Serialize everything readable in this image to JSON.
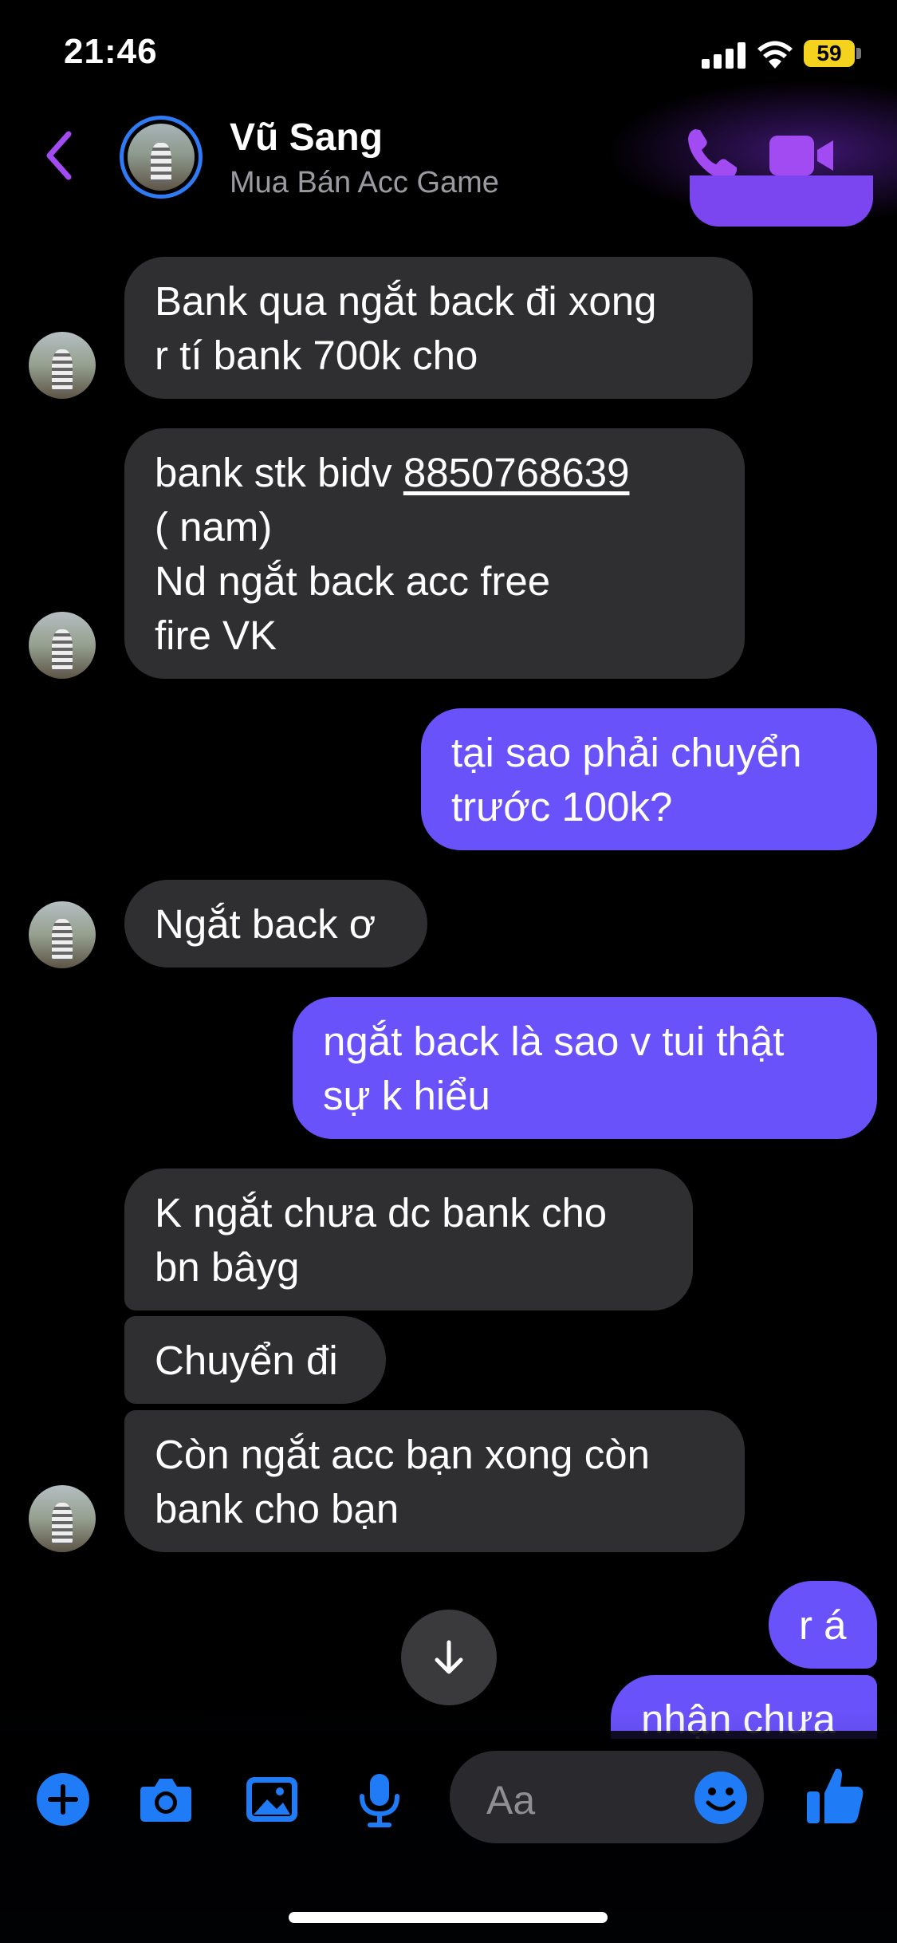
{
  "status_bar": {
    "time": "21:46",
    "battery": "59"
  },
  "header": {
    "contact_name": "Vũ Sang",
    "contact_subtitle": "Mua Bán Acc Game"
  },
  "messages": [
    {
      "direction": "incoming",
      "lines": [
        "Bank qua ngắt back đi xong",
        "r tí bank 700k cho"
      ]
    },
    {
      "direction": "incoming",
      "line1_prefix": "bank stk bidv ",
      "account_number": "8850768639",
      "lines": [
        "( nam)",
        "Nd ngắt back acc free",
        "fire VK"
      ]
    },
    {
      "direction": "outgoing",
      "lines": [
        "tại sao phải chuyển",
        "trước 100k?"
      ]
    },
    {
      "direction": "incoming",
      "lines": [
        "Ngắt back ơ"
      ]
    },
    {
      "direction": "outgoing",
      "lines": [
        "ngắt back là sao v tui thật",
        "sự k hiểu"
      ]
    },
    {
      "direction": "incoming",
      "lines": [
        "K ngắt chưa dc bank cho",
        "bn bâyg"
      ]
    },
    {
      "direction": "incoming",
      "lines": [
        "Chuyển đi"
      ]
    },
    {
      "direction": "incoming",
      "lines": [
        "Còn ngắt acc bạn xong còn",
        "bank cho bạn"
      ]
    },
    {
      "direction": "outgoing",
      "lines": [
        "r á"
      ]
    },
    {
      "direction": "outgoing",
      "lines": [
        "nhận chưa"
      ]
    }
  ],
  "composer": {
    "placeholder": "Aa"
  },
  "colors": {
    "accent": "#a24bf2",
    "outgoing_bubble": "#6a52fb",
    "incoming_bubble": "#2f2f31",
    "toolbar_blue": "#1f7cf6"
  }
}
